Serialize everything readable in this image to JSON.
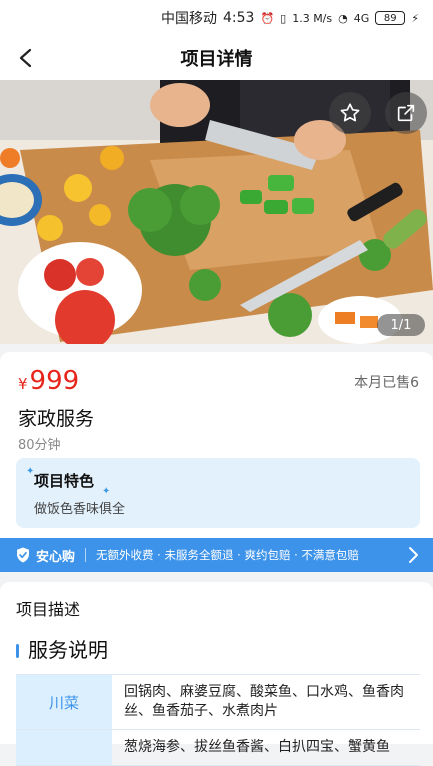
{
  "status_bar": {
    "carrier": "中国移动",
    "time": "4:53",
    "net_speed": "1.3 M/s",
    "signal": "4G",
    "battery": "89"
  },
  "nav": {
    "title": "项目详情"
  },
  "gallery": {
    "page_indicator": "1/1"
  },
  "product": {
    "currency": "¥",
    "price": "999",
    "sold": "本月已售6",
    "name": "家政服务",
    "duration": "80分钟"
  },
  "feature": {
    "title": "项目特色",
    "text": "做饭色香味俱全"
  },
  "assurance": {
    "brand": "安心购",
    "points": [
      "无额外收费",
      "未服务全额退",
      "爽约包赔",
      "不满意包赔"
    ]
  },
  "description": {
    "title": "项目描述",
    "section_title": "服务说明",
    "rows": [
      {
        "category": "川菜",
        "dishes": "回锅肉、麻婆豆腐、酸菜鱼、口水鸡、鱼香肉丝、鱼香茄子、水煮肉片"
      },
      {
        "category": "",
        "dishes": "葱烧海参、拔丝鱼香酱、白扒四宝、蟹黄鱼"
      }
    ]
  },
  "colors": {
    "accent": "#3d93ea",
    "price": "#e8251b",
    "feature_bg": "#e3f1fc"
  }
}
